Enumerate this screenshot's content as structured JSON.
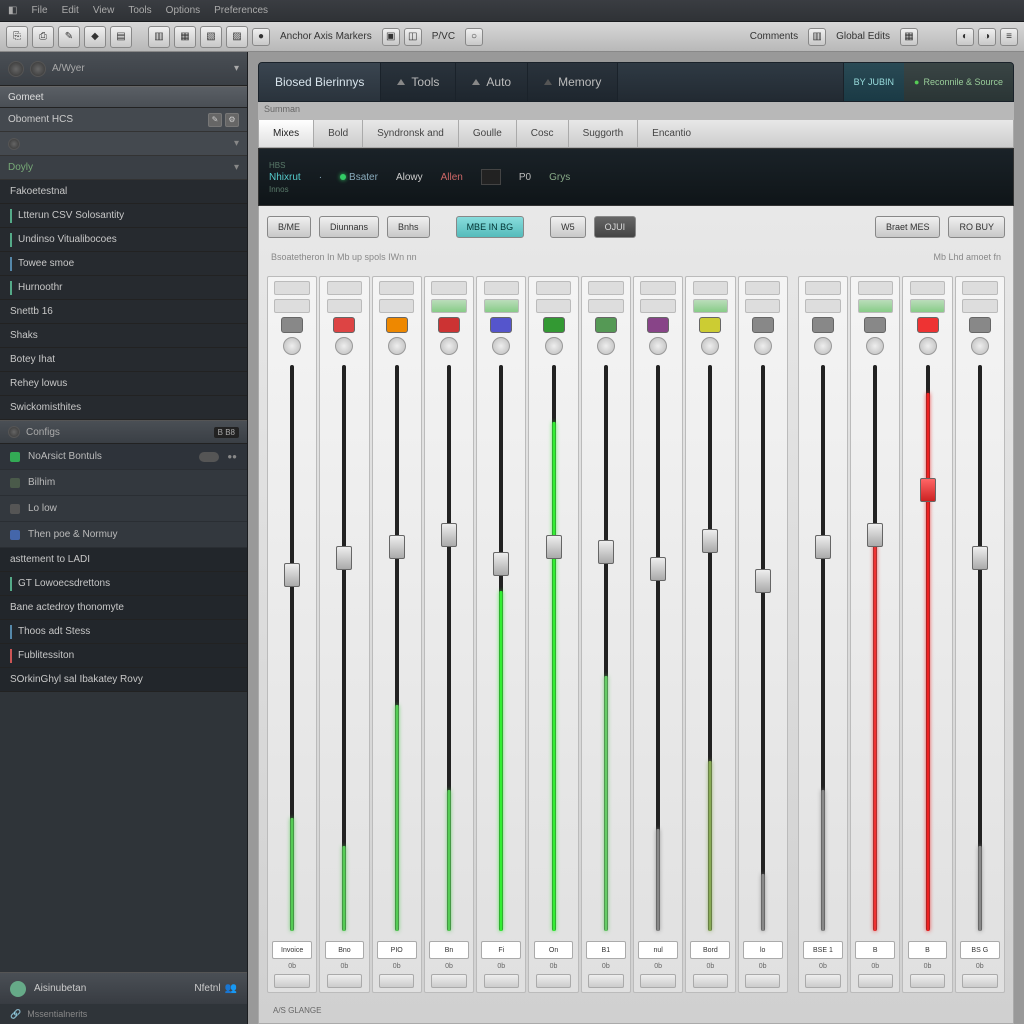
{
  "menu": {
    "items": [
      "File",
      "Edit",
      "View",
      "Tools",
      "Options",
      "Preferences"
    ]
  },
  "toolbar": {
    "section1_icons": [
      "⎘",
      "⎙",
      "✎",
      "◆",
      "▤"
    ],
    "section2_icons": [
      "▥",
      "▦",
      "▧",
      "▨"
    ],
    "label1": "Anchor Axis Markers",
    "mid_icons": [
      "▣",
      "◫"
    ],
    "label2": "P/VC",
    "right_labels": [
      "Comments",
      "Global Edits"
    ],
    "far_icons": [
      "◐",
      "◑",
      "≡"
    ]
  },
  "tabs": {
    "main": [
      {
        "label": "Biosed Bierinnys",
        "active": true
      },
      {
        "label": "Tools"
      },
      {
        "label": "Auto"
      },
      {
        "label": "Memory"
      }
    ],
    "status_a": "BY JUBIN",
    "status_b": "Reconnile & Source"
  },
  "sub_caption": "Summan",
  "viewtabs": [
    {
      "label": "Mixes",
      "active": true
    },
    {
      "label": "Bold"
    },
    {
      "label": "Syndronsk and"
    },
    {
      "label": "Goulle"
    },
    {
      "label": "Cosc"
    },
    {
      "label": "Suggorth"
    },
    {
      "label": "Encantio"
    }
  ],
  "display": {
    "blocks": [
      {
        "top": "HBS",
        "main": "Nhixrut",
        "sub": "Innos"
      },
      {
        "top": "",
        "main": "",
        "sub": ""
      },
      {
        "top": "",
        "main": "Bsater",
        "sub": "",
        "led": true
      },
      {
        "top": "",
        "main": "Alowy",
        "sub": ""
      },
      {
        "top": "",
        "main": "Allen",
        "sub": "",
        "red": true
      },
      {
        "top": "",
        "main": "P0",
        "sub": ""
      },
      {
        "top": "",
        "main": "Grys",
        "sub": ""
      }
    ]
  },
  "buttons": {
    "left": [
      "B/ME",
      "Diunnans",
      "Bnhs"
    ],
    "teal": "MBE IN BG",
    "mid": [
      "W5",
      "OJUI"
    ],
    "right": [
      "Braet MES",
      "RO BUY"
    ]
  },
  "legendA": "Bsoatetheron  In Mb up  spols  IWn nn",
  "legendB": "Mb  Lhd amoet fn",
  "channels": [
    {
      "name": "Invoice",
      "rec_color": "#888",
      "fader": 35,
      "meter_h": 20,
      "meter_c": "#5c5"
    },
    {
      "name": "Bno",
      "rec_color": "#d44",
      "fader": 32,
      "meter_h": 15,
      "meter_c": "#5c5"
    },
    {
      "name": "PIO",
      "rec_color": "#e80",
      "fader": 30,
      "meter_h": 40,
      "meter_c": "#5c5"
    },
    {
      "name": "Bn",
      "rec_color": "#c33",
      "fader": 28,
      "meter_h": 25,
      "meter_c": "#5c5"
    },
    {
      "name": "Fi",
      "rec_color": "#55c",
      "fader": 33,
      "meter_h": 60,
      "meter_c": "#3e3"
    },
    {
      "name": "On",
      "rec_color": "#393",
      "fader": 30,
      "meter_h": 90,
      "meter_c": "#3e3"
    },
    {
      "name": "B1",
      "rec_color": "#595",
      "fader": 31,
      "meter_h": 45,
      "meter_c": "#6c6"
    },
    {
      "name": "nul",
      "rec_color": "#848",
      "fader": 34,
      "meter_h": 18,
      "meter_c": "#888"
    },
    {
      "name": "Bord",
      "rec_color": "#cc3",
      "fader": 29,
      "meter_h": 30,
      "meter_c": "#8a5"
    },
    {
      "name": "lo",
      "rec_color": "#888",
      "fader": 36,
      "meter_h": 10,
      "meter_c": "#888"
    }
  ],
  "bus_channels": [
    {
      "name": "BSE 1",
      "rec_color": "#888",
      "fader": 30,
      "meter_h": 25,
      "meter_c": "#888"
    },
    {
      "name": "B",
      "rec_color": "#888",
      "fader": 28,
      "meter_h": 70,
      "meter_c": "#e33"
    },
    {
      "name": "B",
      "rec_color": "#e33",
      "fader": 20,
      "meter_h": 95,
      "meter_c": "#e22",
      "hot": true
    },
    {
      "name": "BS G",
      "rec_color": "#888",
      "fader": 32,
      "meter_h": 15,
      "meter_c": "#888"
    }
  ],
  "mixer_footer": "A/S GLANGE",
  "sidebar": {
    "top_label": "A/Wyer",
    "s1_header": "Gomeet",
    "s1_row": "Oboment HCS",
    "drop_label": "Doyly",
    "list1": [
      "Fakoetestnal",
      "Ltterun CSV Solosantity",
      "Undinso Vitualibocoes",
      "Towee smoe",
      "Hurnoothr",
      "Snettb 16",
      "Shaks",
      "Botey Ihat",
      "Rehey lowus",
      "Swickomisthites"
    ],
    "sect2": "Configs",
    "sect2_badge": "B  B8",
    "sub2": [
      "NoArsict Bontuls",
      "Bilhim",
      "Lo low",
      "Then poe & Normuy"
    ],
    "list3": [
      "asttement to LADI",
      "GT Lowoecsdrettons",
      "Bane actedroy thonomyte",
      "Thoos adt Stess",
      "Fublitessiton",
      "SOrkinGhyl sal Ibakatey Rovy"
    ],
    "status_label": "Aisinubetan",
    "status_r": "Nfetnl",
    "footer": "Mssentialnerits"
  },
  "colors": {
    "rec_btns": [
      "#888",
      "#d44",
      "#e80",
      "#c33",
      "#55c",
      "#393",
      "#595",
      "#848",
      "#cc3",
      "#888"
    ]
  }
}
